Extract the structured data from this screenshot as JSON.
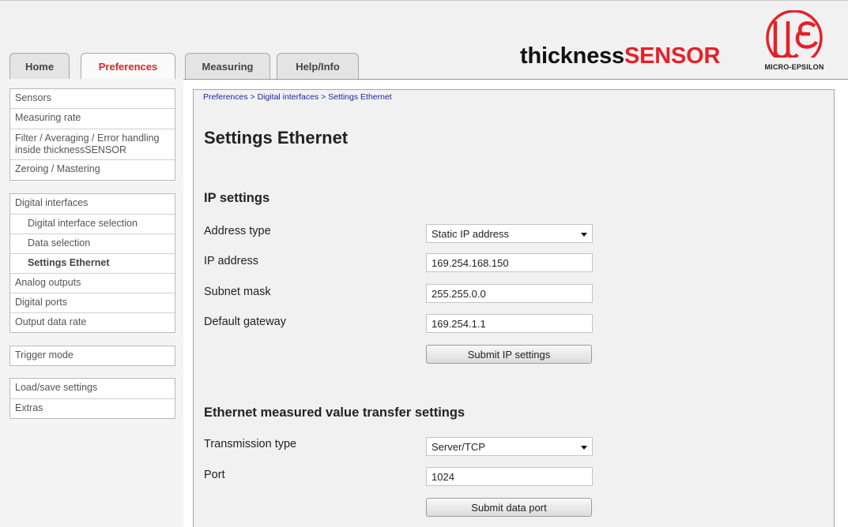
{
  "tabs": [
    {
      "label": "Home"
    },
    {
      "label": "Preferences"
    },
    {
      "label": "Measuring"
    },
    {
      "label": "Help/Info"
    }
  ],
  "brand": {
    "part1": "thickness",
    "part2": "SENSOR",
    "logo_text": "MICRO-EPSILON",
    "accent": "#e32228"
  },
  "sidebar": {
    "group1": [
      {
        "label": "Sensors"
      },
      {
        "label": "Measuring rate"
      },
      {
        "label": "Filter / Averaging / Error handling inside thicknessSENSOR"
      },
      {
        "label": "Zeroing / Mastering"
      }
    ],
    "group2": [
      {
        "label": "Digital interfaces"
      },
      {
        "label": "Digital interface selection"
      },
      {
        "label": "Data selection"
      },
      {
        "label": "Settings Ethernet"
      },
      {
        "label": "Analog outputs"
      },
      {
        "label": "Digital ports"
      },
      {
        "label": "Output data rate"
      }
    ],
    "group3": [
      {
        "label": "Trigger mode"
      }
    ],
    "group4": [
      {
        "label": "Load/save settings"
      },
      {
        "label": "Extras"
      }
    ]
  },
  "breadcrumb": "Preferences > Digital interfaces > Settings Ethernet",
  "page_title": "Settings Ethernet",
  "ip_settings": {
    "title": "IP settings",
    "address_type_label": "Address type",
    "address_type_value": "Static IP address",
    "ip_label": "IP address",
    "ip_value": "169.254.168.150",
    "subnet_label": "Subnet mask",
    "subnet_value": "255.255.0.0",
    "gateway_label": "Default gateway",
    "gateway_value": "169.254.1.1",
    "submit_label": "Submit IP settings"
  },
  "transfer_settings": {
    "title": "Ethernet measured value transfer settings",
    "transmission_label": "Transmission type",
    "transmission_value": "Server/TCP",
    "port_label": "Port",
    "port_value": "1024",
    "submit_label": "Submit data port"
  }
}
